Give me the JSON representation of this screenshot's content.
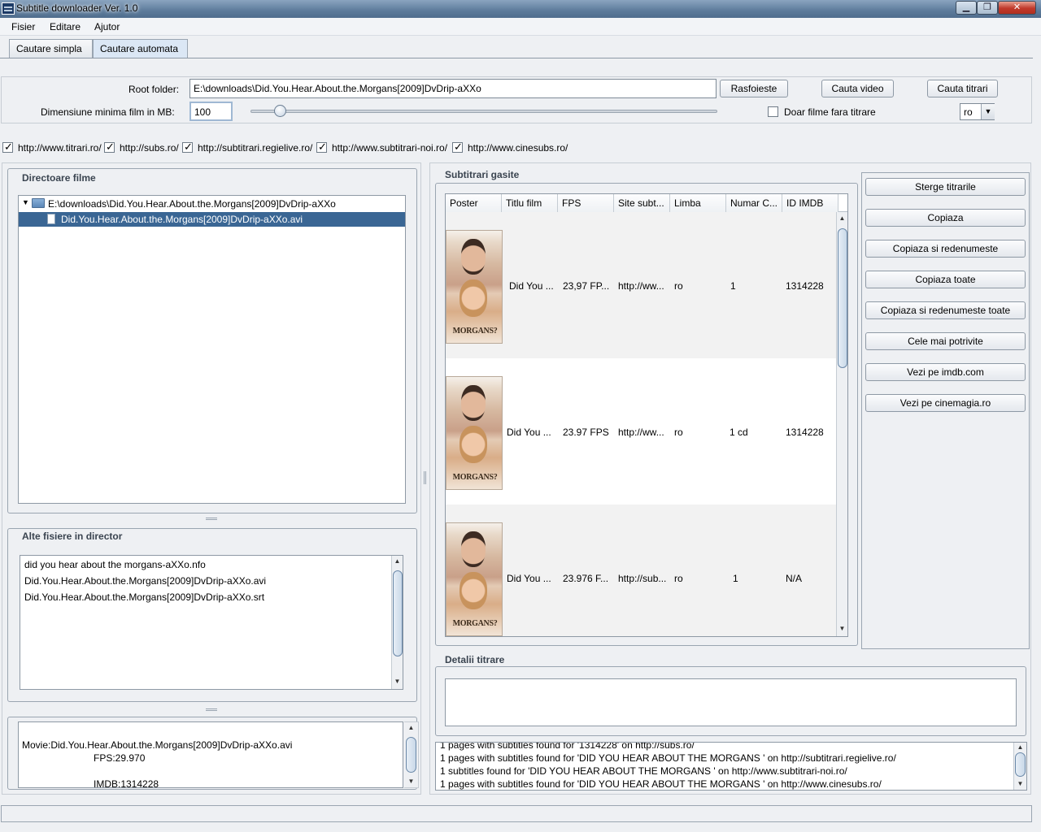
{
  "window": {
    "title": "Subtitle downloader Ver. 1.0",
    "minimize": "▁",
    "maximize": "❐",
    "close": "✕"
  },
  "menu": [
    "Fisier",
    "Editare",
    "Ajutor"
  ],
  "tabs": [
    "Cautare simpla",
    "Cautare automata"
  ],
  "form": {
    "root_label": "Root folder:",
    "root_value": "E:\\downloads\\Did.You.Hear.About.the.Morgans[2009]DvDrip-aXXo",
    "browse_button": "Rasfoieste",
    "search_video_button": "Cauta video",
    "search_subs_button": "Cauta titrari",
    "min_size_label": "Dimensiune minima film in MB:",
    "min_size_value": "100",
    "slider_fraction": 0.04,
    "no_subs_label": "Doar filme fara titrare",
    "language_value": "ro"
  },
  "sites": [
    "http://www.titrari.ro/",
    "http://subs.ro/",
    "http://subtitrari.regielive.ro/",
    "http://www.subtitrari-noi.ro/",
    "http://www.cinesubs.ro/"
  ],
  "movies_panel": {
    "title": "Directoare filme",
    "tree_root": "E:\\downloads\\Did.You.Hear.About.the.Morgans[2009]DvDrip-aXXo",
    "tree_child": "Did.You.Hear.About.the.Morgans[2009]DvDrip-aXXo.avi"
  },
  "other_files_panel": {
    "title": "Alte fisiere in director",
    "files": [
      "did you hear about the morgans-aXXo.nfo",
      "Did.You.Hear.About.the.Morgans[2009]DvDrip-aXXo.avi",
      "Did.You.Hear.About.the.Morgans[2009]DvDrip-aXXo.srt"
    ]
  },
  "info_panel": {
    "movie": "Movie:Did.You.Hear.About.the.Morgans[2009]DvDrip-aXXo.avi",
    "fps": "FPS:29.970",
    "imdb": "IMDB:1314228"
  },
  "results_panel": {
    "title": "Subtitrari gasite",
    "columns": [
      "Poster",
      "Titlu film",
      "FPS",
      "Site subt...",
      "Limba",
      "Numar C...",
      "ID IMDB"
    ],
    "poster_text": "MORGANS?",
    "rows": [
      {
        "title": "Did You ...",
        "fps": "23,97 FP...",
        "site": "http://ww...",
        "lang": "ro",
        "cds": "1",
        "imdb": "1314228"
      },
      {
        "title": "Did You ...",
        "fps": "23.97 FPS",
        "site": "http://ww...",
        "lang": "ro",
        "cds": "1 cd",
        "imdb": "1314228"
      },
      {
        "title": "Did You ...",
        "fps": "23.976 F...",
        "site": "http://sub...",
        "lang": "ro",
        "cds": "1",
        "imdb": "N/A"
      }
    ]
  },
  "actions": [
    "Sterge titrarile",
    "Copiaza",
    "Copiaza si redenumeste",
    "Copiaza toate",
    "Copiaza si redenumeste toate",
    "Cele mai potrivite",
    "Vezi pe imdb.com",
    "Vezi pe cinemagia.ro"
  ],
  "details_panel": {
    "title": "Detalii titrare"
  },
  "log": [
    "1 pages with subtitles found for '1314228' on http://subs.ro/",
    "1 pages with subtitles found for 'DID YOU HEAR ABOUT THE MORGANS ' on http://subtitrari.regielive.ro/",
    "1 subtitles found for 'DID YOU HEAR ABOUT THE MORGANS ' on http://www.subtitrari-noi.ro/",
    "1 pages with subtitles found for 'DID YOU HEAR ABOUT THE MORGANS ' on http://www.cinesubs.ro/"
  ],
  "status_bar": ""
}
